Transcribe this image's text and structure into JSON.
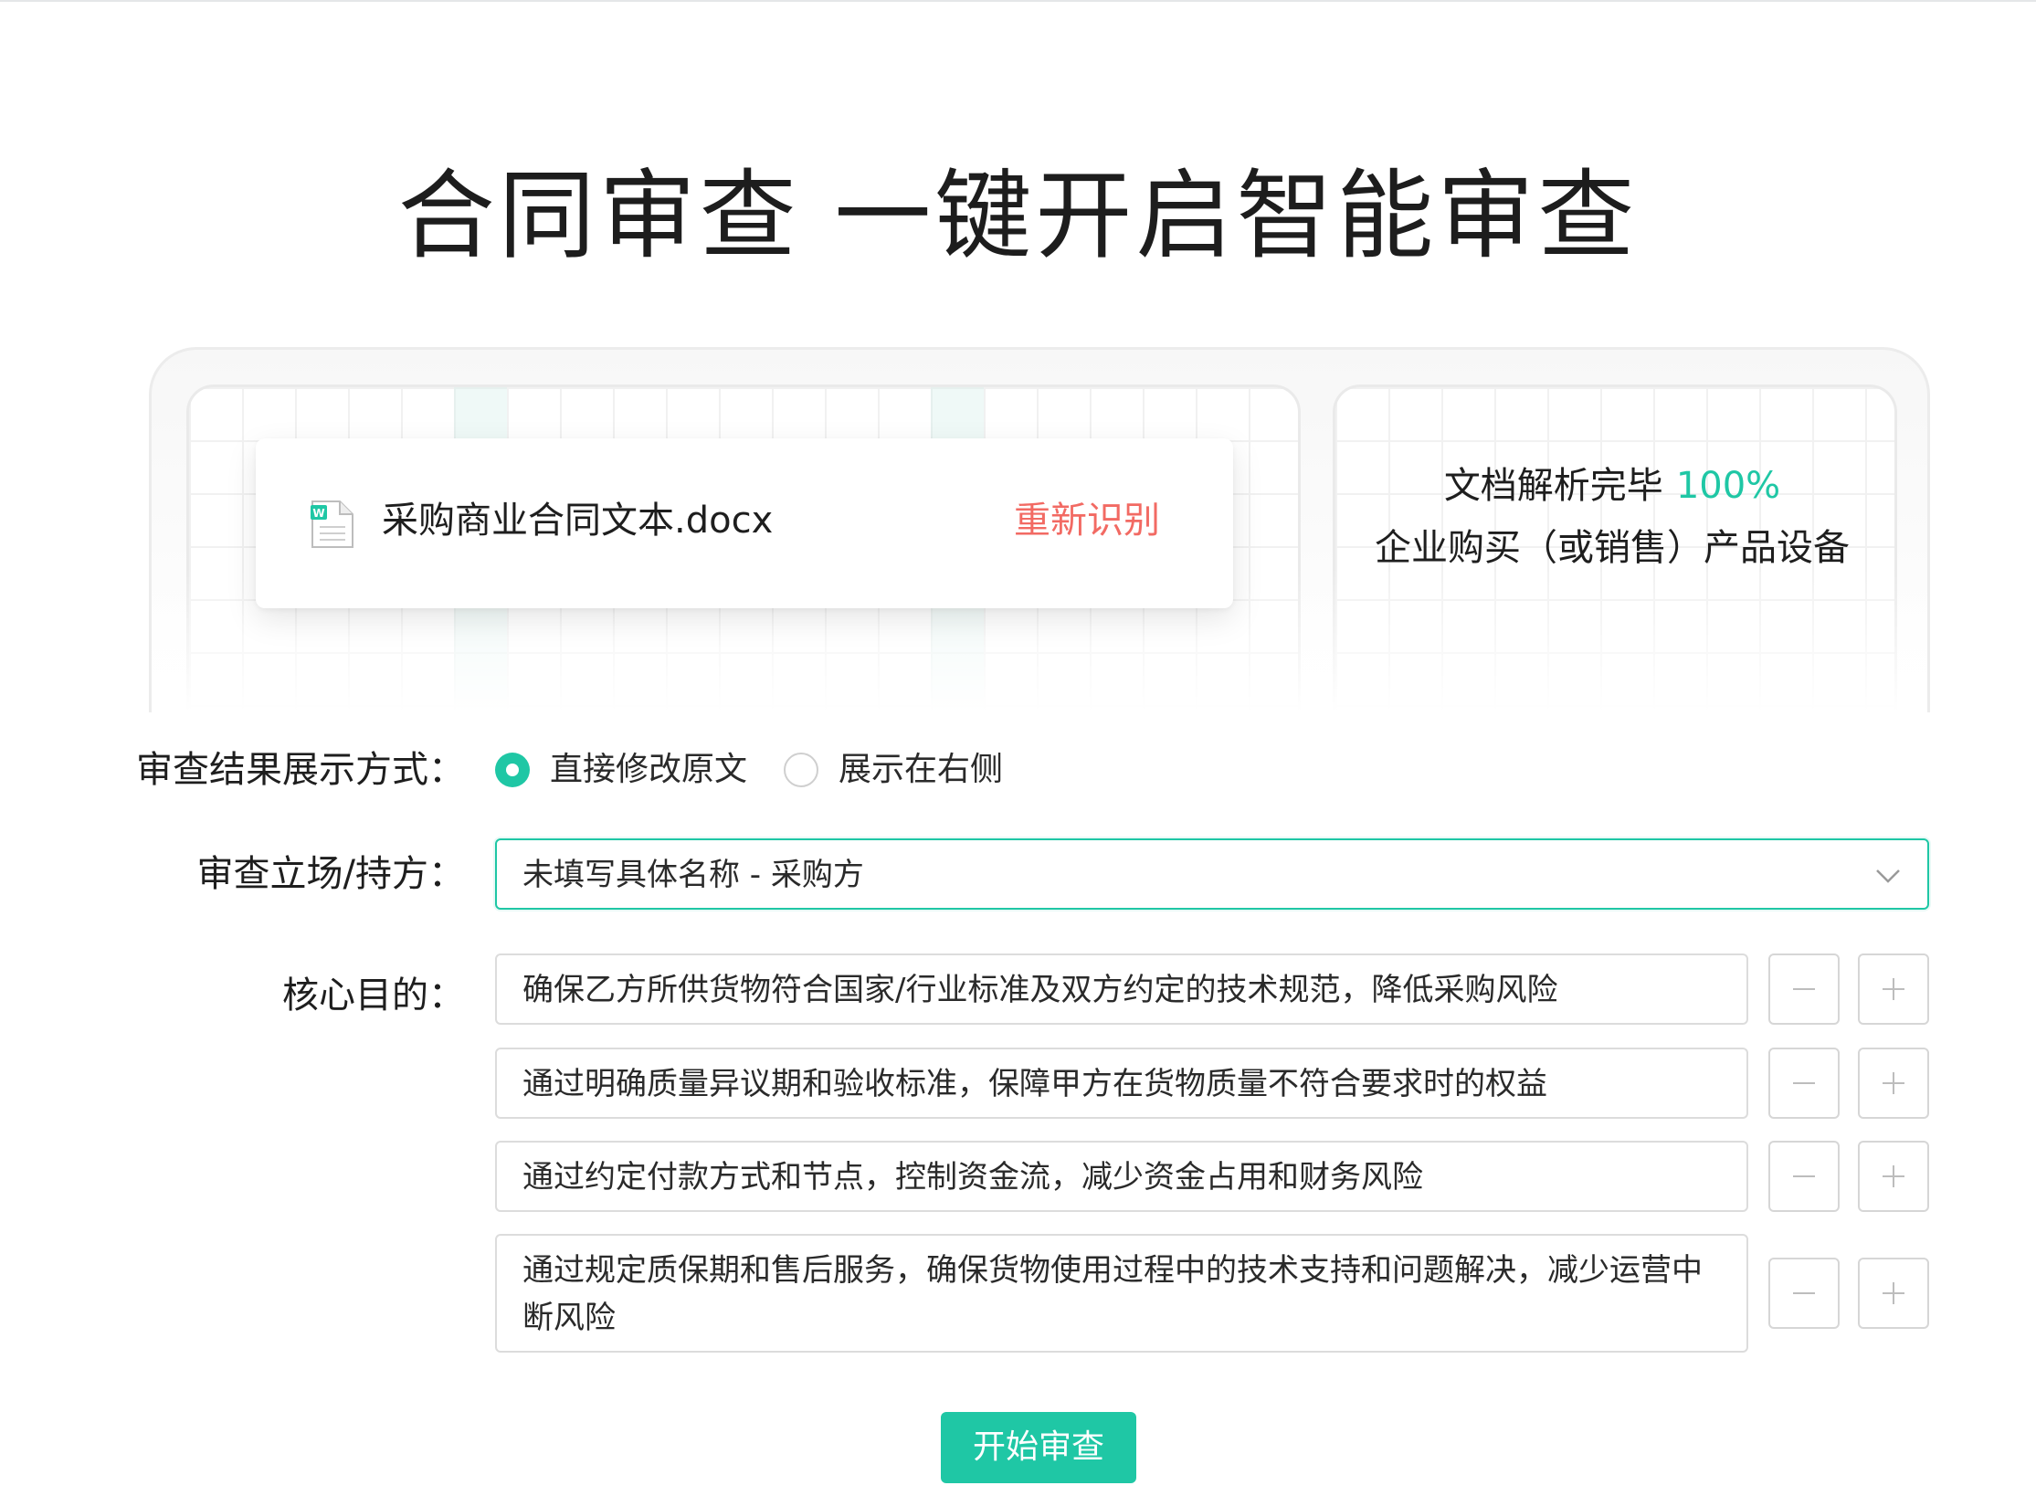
{
  "header": {
    "title": "合同审查  一键开启智能审查"
  },
  "upload": {
    "file_name": "采购商业合同文本.docx",
    "reparse_label": "重新识别",
    "file_icon": "word-document-icon"
  },
  "analysis": {
    "status_text": "文档解析完毕",
    "progress_text": "100%",
    "progress": 1.0,
    "contract_type": "企业购买（或销售）产品设备"
  },
  "form": {
    "display_mode": {
      "label": "审查结果展示方式：",
      "options": [
        {
          "label": "直接修改原文",
          "checked": true
        },
        {
          "label": "展示在右侧",
          "checked": false
        }
      ]
    },
    "stance": {
      "label": "审查立场/持方：",
      "value": "未填写具体名称 - 采购方"
    },
    "goals": {
      "label": "核心目的：",
      "items": [
        "确保乙方所供货物符合国家/行业标准及双方约定的技术规范，降低采购风险",
        "通过明确质量异议期和验收标准，保障甲方在货物质量不符合要求时的权益",
        "通过约定付款方式和节点，控制资金流，减少资金占用和财务风险",
        "通过规定质保期和售后服务，确保货物使用过程中的技术支持和问题解决，减少运营中断风险"
      ],
      "remove_icon": "minus-icon",
      "add_icon": "plus-icon"
    }
  },
  "actions": {
    "start_label": "开始审查"
  },
  "colors": {
    "accent": "#1fc7a5",
    "danger_link": "#f26a63",
    "border": "#dcdcdc"
  }
}
